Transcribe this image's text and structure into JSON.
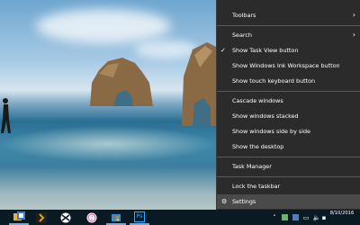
{
  "context_menu": {
    "toolbars": "Toolbars",
    "search": "Search",
    "show_task_view": "Show Task View button",
    "show_ink_workspace": "Show Windows Ink Workspace button",
    "show_touch_keyboard": "Show touch keyboard button",
    "cascade": "Cascade windows",
    "stacked": "Show windows stacked",
    "side_by_side": "Show windows side by side",
    "show_desktop": "Show the desktop",
    "task_manager": "Task Manager",
    "lock_taskbar": "Lock the taskbar",
    "settings": "Settings"
  },
  "taskbar": {
    "pinned_apps": [
      "file-explorer-icon",
      "plex-icon",
      "xbox-icon",
      "itunes-icon",
      "store-icon",
      "photoshop-icon"
    ],
    "photoshop_label": "Ps",
    "clock_time": "",
    "clock_date": "8/10/2016"
  },
  "colors": {
    "menu_bg": "#2b2b2b",
    "menu_hover": "#4a4a4a",
    "taskbar_bg": "#0a1a22"
  }
}
